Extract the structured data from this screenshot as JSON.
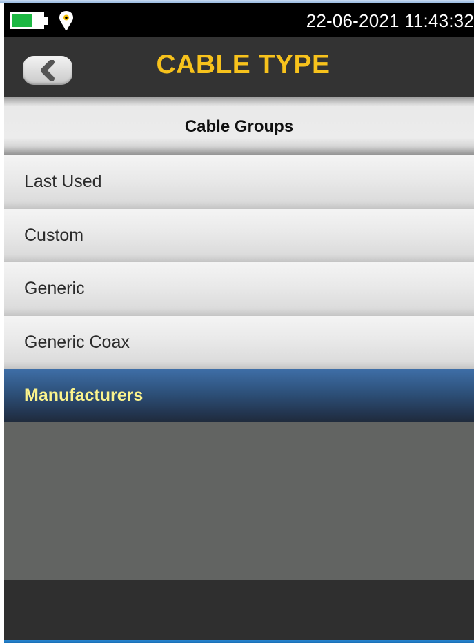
{
  "status_bar": {
    "datetime": "22-06-2021 11:43:32",
    "battery_level": 0.65,
    "battery_color": "#1db843",
    "location_icon": "location-pin-icon"
  },
  "header": {
    "back_icon": "back-chevron-icon",
    "title": "CABLE TYPE",
    "title_color": "#f7c21c"
  },
  "section": {
    "title": "Cable Groups"
  },
  "list": {
    "items": [
      {
        "label": "Last Used",
        "selected": false
      },
      {
        "label": "Custom",
        "selected": false
      },
      {
        "label": "Generic",
        "selected": false
      },
      {
        "label": "Generic Coax",
        "selected": false
      },
      {
        "label": "Manufacturers",
        "selected": true
      }
    ],
    "selected_color": "#2d5079",
    "selected_text_color": "#fbf38c"
  }
}
